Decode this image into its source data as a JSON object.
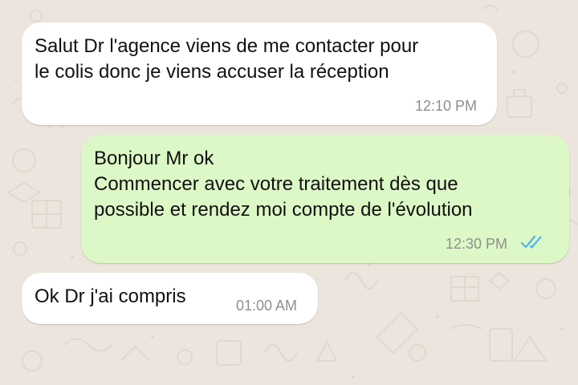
{
  "theme": {
    "chat_background": "#ece5dd",
    "incoming_bubble": "#ffffff",
    "outgoing_bubble": "#dcf8c6",
    "timestamp_color": "#8f8f8f",
    "read_receipt_color": "#4fb6ec"
  },
  "conversation": {
    "messages": [
      {
        "direction": "incoming",
        "lines": [
          "Salut Dr l'agence viens de me contacter pour",
          "le colis donc je viens accuser la réception"
        ],
        "time": "12:10 PM"
      },
      {
        "direction": "outgoing",
        "lines": [
          "Bonjour Mr ok",
          "Commencer avec votre traitement dès que",
          "possible et rendez moi compte de l'évolution"
        ],
        "time": "12:30 PM",
        "status_icon": "double-check-read-icon"
      },
      {
        "direction": "incoming",
        "lines": [
          "Ok Dr j'ai compris"
        ],
        "time": "01:00 AM"
      }
    ]
  }
}
